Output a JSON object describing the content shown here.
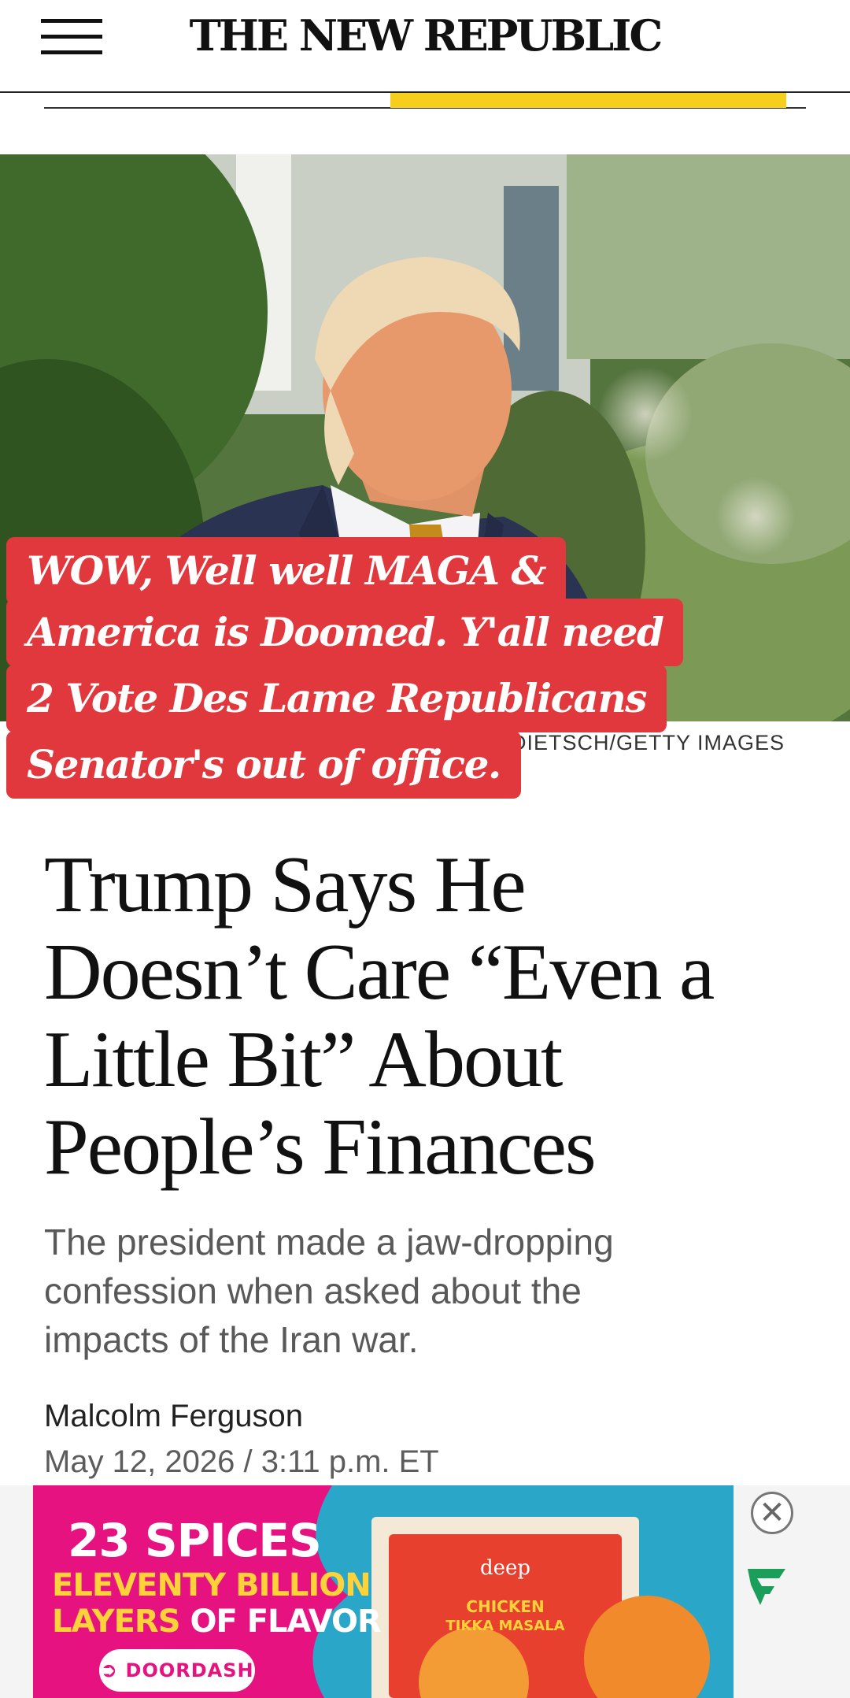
{
  "header": {
    "logo_text": "THE NEW REPUBLIC",
    "reading_progress": 0.52
  },
  "hero": {
    "photo_credit": "N DIETSCH/GETTY IMAGES"
  },
  "overlay": {
    "lines": [
      "WOW, Well well MAGA &",
      "America is Doomed. Y'all need",
      "2 Vote Des Lame Republicans",
      "Senator's out of office."
    ]
  },
  "article": {
    "headline_lines": [
      "Trump Says He",
      "Doesn’t Care “Even a",
      "Little Bit” About",
      "People’s Finances"
    ],
    "dek_lines": [
      "The president made a jaw-dropping",
      "confession when asked about the",
      "impacts of the Iran war."
    ],
    "author": "Malcolm Ferguson",
    "dateline": "May 12, 2026 / 3:11 p.m. ET"
  },
  "ad": {
    "title": "23 SPICES",
    "line2": "ELEVENTY BILLION",
    "line3_a": "LAYERS",
    "line3_b": "OF FLAVOR",
    "cta": "DOORDASH",
    "box_brand": "deep",
    "box_product_1": "CHICKEN",
    "box_product_2": "TIKKA MASALA",
    "close_glyph": "✕"
  },
  "colors": {
    "progress_accent": "#f5cf1c",
    "overlay_red": "#e0383c",
    "ad_pink": "#e6127f",
    "ad_yellow": "#ffd23a",
    "brand_green": "#1a9e5a"
  }
}
